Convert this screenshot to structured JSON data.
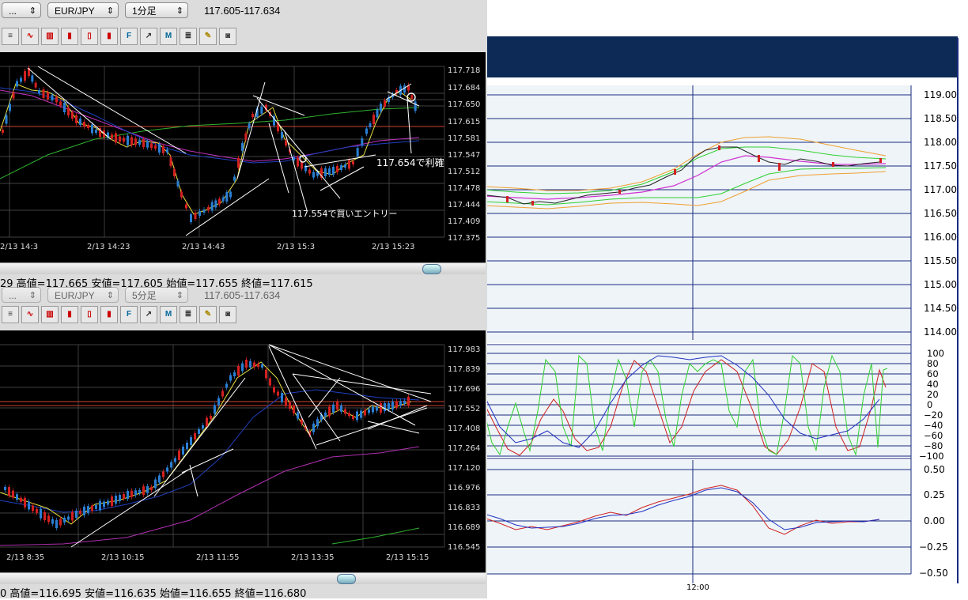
{
  "top_window": {
    "selectors": {
      "symbol_prefix": "...",
      "pair": "EUR/JPY",
      "timeframe": "1分足"
    },
    "quote": "117.605-117.634",
    "y_ticks": [
      "117.718",
      "117.684",
      "117.650",
      "117.615",
      "117.581",
      "117.547",
      "117.512",
      "117.478",
      "117.444",
      "117.409",
      "117.375"
    ],
    "x_ticks": [
      "2/13 14:3",
      "2/13 14:23",
      "2/13 14:43",
      "2/13 15:3",
      "2/13 15:23"
    ],
    "annotation_exit": "117.654で利確",
    "annotation_entry": "117.554で買いエントリー",
    "status": "29  高値=117.665 安値=117.605 始値=117.655 終値=117.615"
  },
  "bottom_window": {
    "selectors": {
      "symbol_prefix": "...",
      "pair": "EUR/JPY",
      "timeframe": "5分足"
    },
    "quote": "117.605-117.634",
    "y_ticks": [
      "117.983",
      "117.839",
      "117.696",
      "117.552",
      "117.408",
      "117.264",
      "117.120",
      "116.976",
      "116.833",
      "116.689",
      "116.545"
    ],
    "x_ticks": [
      "2/13 8:35",
      "2/13 10:15",
      "2/13 11:55",
      "2/13 13:35",
      "2/13 15:15"
    ],
    "status": "0  高値=116.695 安値=116.635 始値=116.655 終値=116.680"
  },
  "right_panel": {
    "price_ticks": [
      "119.00",
      "118.50",
      "118.00",
      "117.50",
      "117.00",
      "116.50",
      "116.00",
      "115.50",
      "115.00",
      "114.50",
      "114.00"
    ],
    "osc_ticks": [
      "100",
      "80",
      "60",
      "40",
      "20",
      "0",
      "−20",
      "−40",
      "−60",
      "−80",
      "−100"
    ],
    "macd_ticks": [
      "0.50",
      "0.25",
      "0.00",
      "−0.25",
      "−0.50"
    ],
    "time_label": "12:00"
  },
  "icons": [
    "trendline-icon",
    "line-chart-icon",
    "bar-chart-icon",
    "candle-chart-icon",
    "candle-chart-2-icon",
    "candle-chart-3-icon",
    "fix-icon",
    "arrow-icon",
    "mfix-icon",
    "indicator-icon",
    "pencil-icon",
    "camera-icon"
  ],
  "colors": {
    "chart_bg": "#000000",
    "navy_header": "#0d2a57",
    "panel_bg": "#eef4f8",
    "grid_navy": "#1a2a80",
    "up_candle": "#2a7fd4",
    "down_candle": "#d42020"
  }
}
